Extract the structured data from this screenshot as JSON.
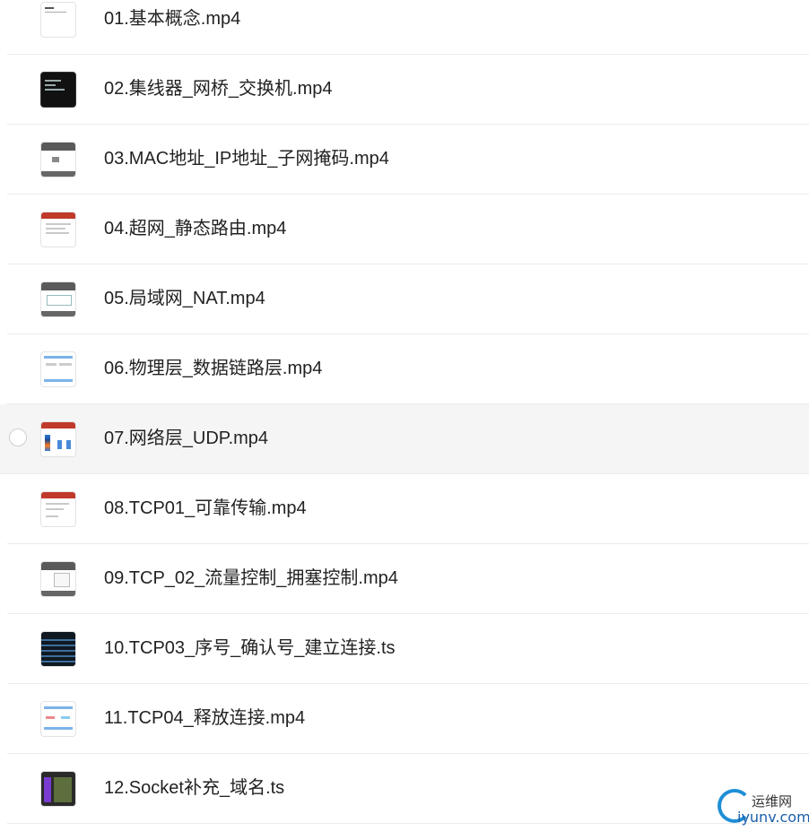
{
  "files": [
    {
      "name": "01.基本概念.mp4",
      "thumb": "doc"
    },
    {
      "name": "02.集线器_网桥_交换机.mp4",
      "thumb": "dark"
    },
    {
      "name": "03.MAC地址_IP地址_子网掩码.mp4",
      "thumb": "net"
    },
    {
      "name": "04.超网_静态路由.mp4",
      "thumb": "ppt"
    },
    {
      "name": "05.局域网_NAT.mp4",
      "thumb": "net"
    },
    {
      "name": "06.物理层_数据链路层.mp4",
      "thumb": "ui"
    },
    {
      "name": "07.网络层_UDP.mp4",
      "thumb": "ppt",
      "hovered": true
    },
    {
      "name": "08.TCP01_可靠传输.mp4",
      "thumb": "ppt"
    },
    {
      "name": "09.TCP_02_流量控制_拥塞控制.mp4",
      "thumb": "net"
    },
    {
      "name": "10.TCP03_序号_确认号_建立连接.ts",
      "thumb": "terminal"
    },
    {
      "name": "11.TCP04_释放连接.mp4",
      "thumb": "ui"
    },
    {
      "name": "12.Socket补充_域名.ts",
      "thumb": "sock"
    }
  ],
  "watermark": {
    "cn": "运维网",
    "en": "iyunv.com"
  },
  "colors": {
    "hover_bg": "#f5f5f5",
    "divider": "#ebebeb",
    "watermark_blue": "#1f8fd6"
  }
}
